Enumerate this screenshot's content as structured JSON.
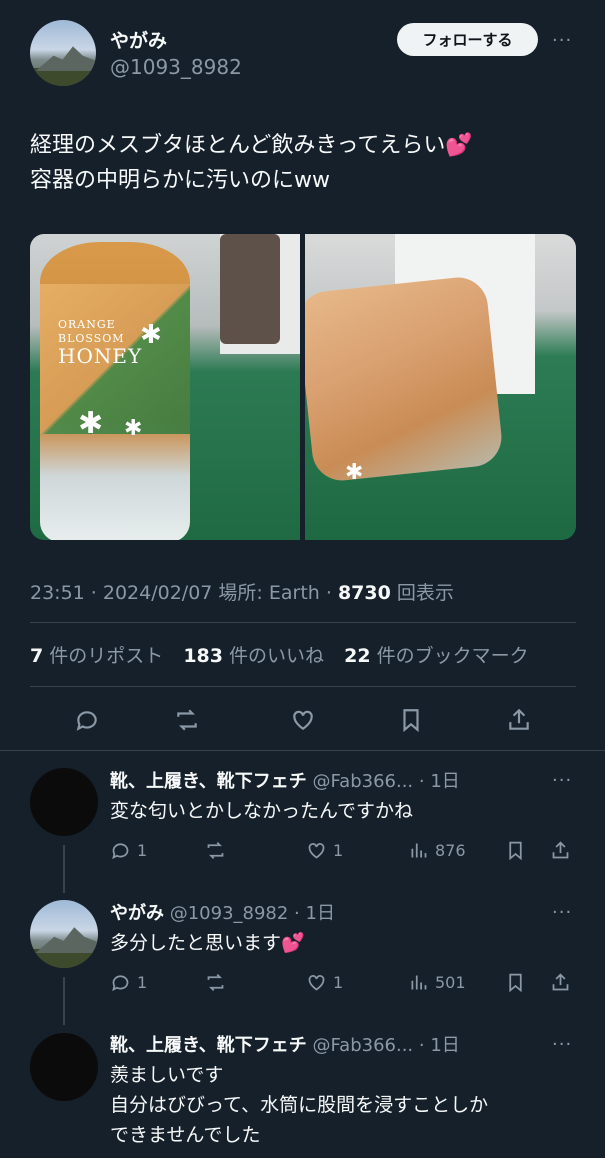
{
  "main": {
    "name": "やがみ",
    "handle": "@1093_8982",
    "follow_label": "フォローする",
    "more": "···",
    "text_line1": "経理のメスブタほとんど飲みきってえらい💕",
    "text_line2": "容器の中明らかに汚いのにww",
    "photo_label_1": "ORANGE",
    "photo_label_2": "BLOSSOM",
    "photo_label_3": "HONEY",
    "meta_time": "23:51 · 2024/02/07 場所: Earth · ",
    "meta_views": "8730",
    "meta_views_suffix": " 回表示",
    "reposts_count": "7",
    "reposts_label": " 件のリポスト",
    "likes_count": "183",
    "likes_label": " 件のいいね",
    "bookmarks_count": "22",
    "bookmarks_label": " 件のブックマーク"
  },
  "replies": [
    {
      "name": "靴、上履き、靴下フェチ",
      "handle": " @Fab366... · 1日",
      "line1": "変な匂いとかしなかったんですかね",
      "replies": "1",
      "likes": "1",
      "views": "876"
    },
    {
      "name": "やがみ",
      "handle": " @1093_8982 · 1日",
      "line1": "多分したと思います💕",
      "replies": "1",
      "likes": "1",
      "views": "501"
    },
    {
      "name": "靴、上履き、靴下フェチ",
      "handle": " @Fab366... · 1日",
      "line1": "羨ましいです",
      "line2": "自分はびびって、水筒に股間を浸すことしか",
      "line3": "できませんでした"
    }
  ],
  "more_icon": "···",
  "colors": {
    "background": "#15202b",
    "text": "#f7f9f9",
    "muted": "#8b98a5",
    "divider": "#38444d"
  }
}
